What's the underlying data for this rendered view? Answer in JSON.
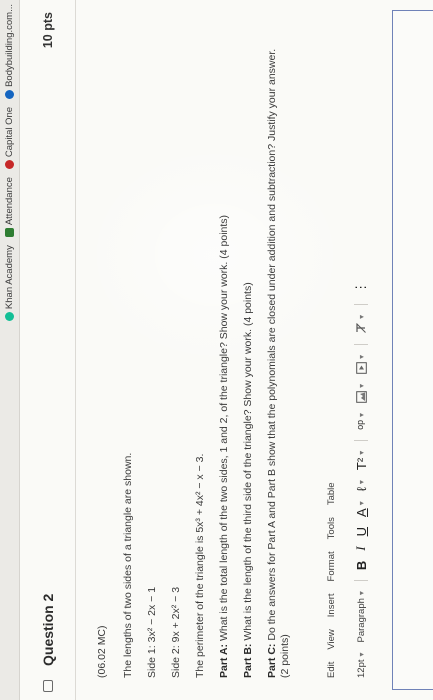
{
  "bookmarks": [
    {
      "label": "Khan Academy",
      "color": "#14bf96"
    },
    {
      "label": "Attendance",
      "color": "#2e7d32"
    },
    {
      "label": "Capital One",
      "color": "#c62828"
    },
    {
      "label": "Bodybuilding.com...",
      "color": "#1565c0"
    }
  ],
  "question": {
    "title": "Question 2",
    "points": "10 pts",
    "code": "(06.02 MC)",
    "intro": "The lengths of two sides of a triangle are shown.",
    "side1": "Side 1: 3x² − 2x − 1",
    "side2": "Side 2: 9x + 2x² − 3",
    "perimeter": "The perimeter of the triangle is 5x³ + 4x² − x − 3.",
    "partA_label": "Part A:",
    "partA_text": "What is the total length of the two sides, 1 and 2, of the triangle? Show your work. (4 points)",
    "partB_label": "Part B:",
    "partB_text": "What is the length of the third side of the triangle? Show your work. (4 points)",
    "partC_label": "Part C:",
    "partC_text": "Do the answers for Part A and Part B show that the polynomials are closed under addition and subtraction? Justify your answer. (2 points)"
  },
  "editor": {
    "menu": [
      "Edit",
      "View",
      "Insert",
      "Format",
      "Tools",
      "Table"
    ],
    "font_size": "12pt",
    "block_format": "Paragraph",
    "bold": "B",
    "italic": "I",
    "underline": "U",
    "text_color": "A",
    "highlight": "ℓ",
    "superscript": "T²",
    "link": "ᵒᵖ",
    "more": "⋮"
  }
}
